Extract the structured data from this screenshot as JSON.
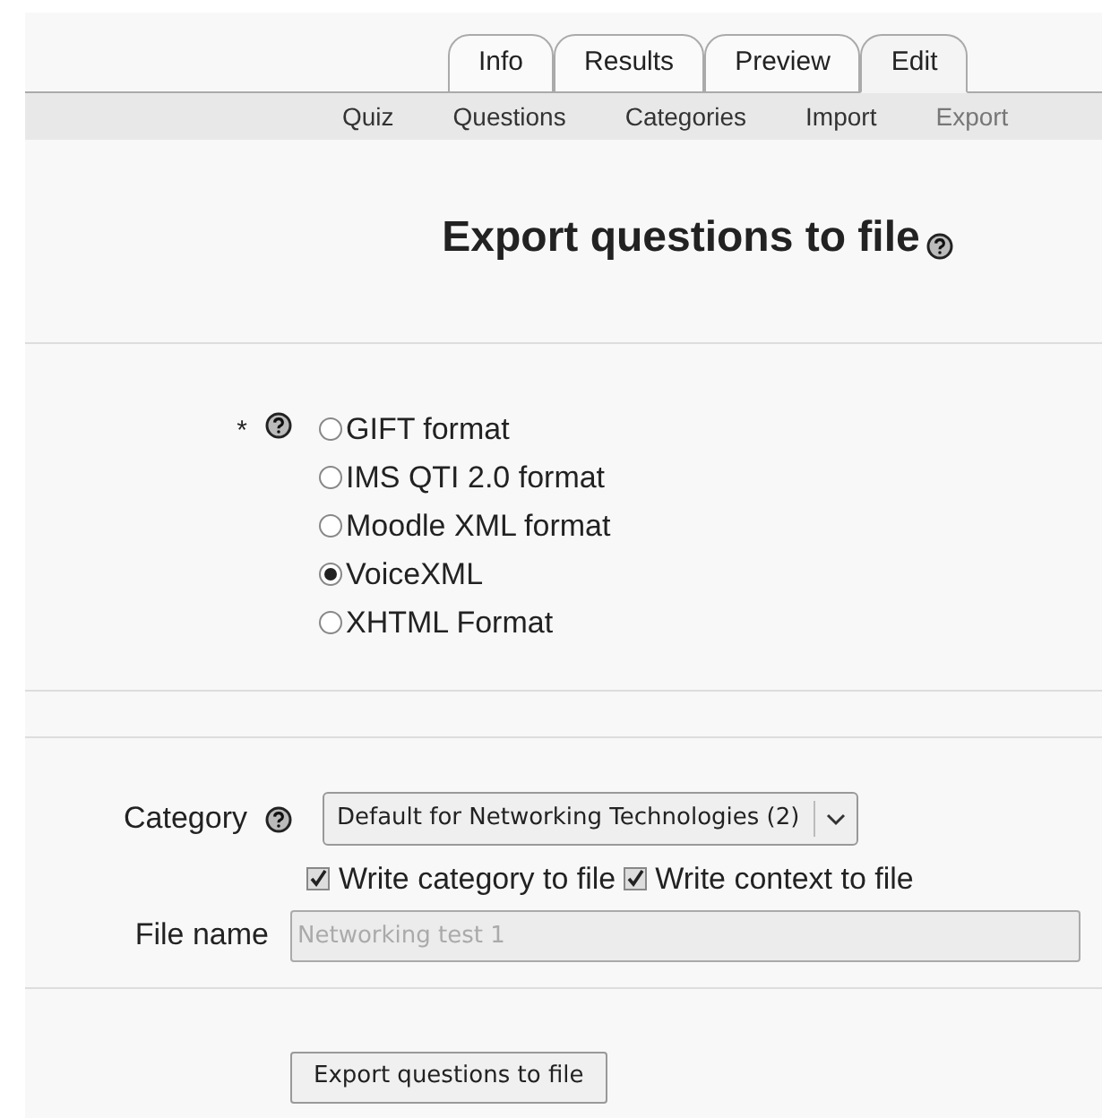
{
  "tabs": [
    {
      "label": "Info",
      "selected": false
    },
    {
      "label": "Results",
      "selected": false
    },
    {
      "label": "Preview",
      "selected": false
    },
    {
      "label": "Edit",
      "selected": true
    }
  ],
  "subtabs": [
    {
      "label": "Quiz",
      "selected": false
    },
    {
      "label": "Questions",
      "selected": false
    },
    {
      "label": "Categories",
      "selected": false
    },
    {
      "label": "Import",
      "selected": false
    },
    {
      "label": "Export",
      "selected": true
    }
  ],
  "heading": "Export questions to file",
  "format": {
    "required_mark": "*",
    "options": [
      {
        "label": "GIFT format",
        "selected": false
      },
      {
        "label": "IMS QTI 2.0 format",
        "selected": false
      },
      {
        "label": "Moodle XML format",
        "selected": false
      },
      {
        "label": "VoiceXML",
        "selected": true
      },
      {
        "label": "XHTML Format",
        "selected": false
      }
    ]
  },
  "category": {
    "label": "Category",
    "value": "Default for Networking Technologies (2)"
  },
  "checkboxes": [
    {
      "label": "Write category to file",
      "checked": true
    },
    {
      "label": "Write context to file",
      "checked": true
    }
  ],
  "file_name": {
    "label": "File name",
    "placeholder": "Networking test 1"
  },
  "submit": "Export questions to file"
}
